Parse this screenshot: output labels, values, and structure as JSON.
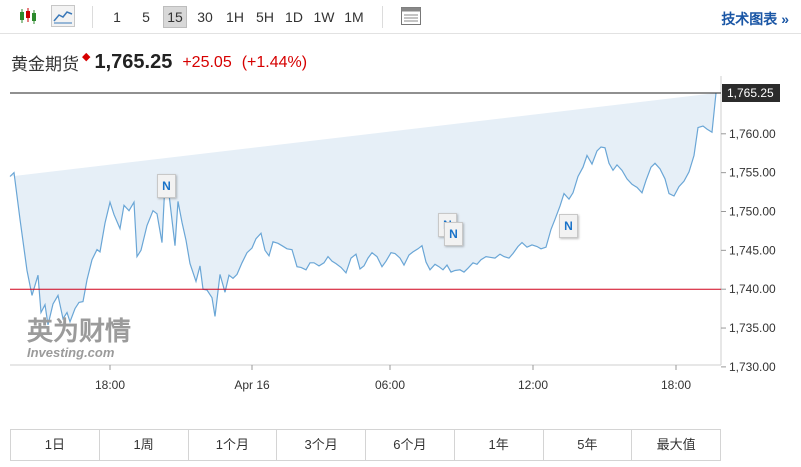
{
  "toolbar": {
    "chart_type_icons": [
      "candlestick-icon",
      "line-chart-icon"
    ],
    "timeframes": [
      "1",
      "5",
      "15",
      "30",
      "1H",
      "5H",
      "1D",
      "1W",
      "1M"
    ],
    "active_timeframe": "15",
    "settings_icon": "table-settings-icon",
    "tech_chart_label": "技术图表 »"
  },
  "header": {
    "name": "黄金期货",
    "arrow": "◆",
    "price": "1,765.25",
    "change": "+25.05",
    "change_pct": "(+1.44%)"
  },
  "watermark": {
    "cn": "英为财情",
    "en": "Investing.com"
  },
  "news_flags": [
    "N",
    "N",
    "N",
    "N"
  ],
  "range_buttons": [
    "1日",
    "1周",
    "1个月",
    "3个月",
    "6个月",
    "1年",
    "5年",
    "最大值"
  ],
  "colors": {
    "line": "#6aa6d6",
    "area": "#e6eff7",
    "ref_line": "#d0021b",
    "price_line": "#222222",
    "up": "#d60000",
    "link": "#1a56a5"
  },
  "chart_data": {
    "type": "area",
    "yticks": [
      "1,730.00",
      "1,735.00",
      "1,740.00",
      "1,745.00",
      "1,750.00",
      "1,755.00",
      "1,760.00"
    ],
    "ylim": [
      1729.4,
      1770
    ],
    "xticks": [
      {
        "label": "18:00",
        "x": 100
      },
      {
        "label": "Apr 16",
        "x": 242
      },
      {
        "label": "06:00",
        "x": 380
      },
      {
        "label": "12:00",
        "x": 523
      },
      {
        "label": "18:00",
        "x": 666
      }
    ],
    "xlim": [
      0,
      711
    ],
    "reference_line": 1740.0,
    "last_price_label": "1,765.25",
    "last_price": 1765.25,
    "x": [
      0,
      4,
      10,
      17,
      22,
      28,
      31,
      35,
      38,
      43,
      48,
      53,
      57,
      60,
      65,
      69,
      73,
      77,
      82,
      87,
      90,
      95,
      100,
      104,
      110,
      114,
      119,
      124,
      127,
      131,
      137,
      143,
      147,
      152,
      155,
      158,
      162,
      165,
      168,
      172,
      176,
      180,
      186,
      190,
      193,
      197,
      202,
      205,
      210,
      215,
      219,
      223,
      227,
      232,
      237,
      242,
      246,
      251,
      255,
      259,
      263,
      268,
      272,
      277,
      282,
      287,
      291,
      296,
      300,
      304,
      309,
      314,
      318,
      322,
      326,
      331,
      336,
      341,
      346,
      350,
      354,
      358,
      362,
      367,
      372,
      376,
      381,
      385,
      390,
      394,
      399,
      403,
      408,
      412,
      416,
      420,
      425,
      429,
      433,
      437,
      441,
      445,
      450,
      454,
      458,
      463,
      467,
      471,
      476,
      480,
      485,
      490,
      494,
      499,
      503,
      508,
      512,
      517,
      522,
      527,
      531,
      536,
      541,
      545,
      550,
      554,
      559,
      563,
      568,
      573,
      577,
      582,
      587,
      591,
      595,
      599,
      603,
      607,
      612,
      617,
      622,
      627,
      632,
      636,
      641,
      645,
      650,
      655,
      659,
      664,
      669,
      674,
      679,
      684,
      688,
      693,
      697,
      702,
      706,
      711
    ],
    "values": [
      1754.5,
      1755.0,
      1749.0,
      1742.4,
      1739.2,
      1741.8,
      1737.0,
      1738.0,
      1735.4,
      1738.1,
      1739.2,
      1736.2,
      1737.0,
      1735.8,
      1737.5,
      1738.3,
      1738.4,
      1741.2,
      1743.8,
      1745.1,
      1744.8,
      1748.5,
      1751.2,
      1749.6,
      1747.8,
      1750.8,
      1750.1,
      1751.2,
      1744.2,
      1745.0,
      1748.2,
      1750.1,
      1749.7,
      1746.0,
      1753.7,
      1753.3,
      1748.9,
      1745.6,
      1751.3,
      1748.6,
      1746.3,
      1743.3,
      1741.0,
      1743.0,
      1740.0,
      1739.9,
      1738.9,
      1736.5,
      1741.9,
      1739.6,
      1741.8,
      1741.4,
      1741.9,
      1743.4,
      1744.7,
      1745.3,
      1746.5,
      1747.2,
      1745.0,
      1744.3,
      1746.1,
      1745.9,
      1745.6,
      1745.2,
      1745.1,
      1742.9,
      1742.8,
      1742.5,
      1743.4,
      1743.4,
      1743.0,
      1743.4,
      1744.2,
      1743.6,
      1743.3,
      1742.8,
      1742.1,
      1744.0,
      1744.5,
      1742.6,
      1743.0,
      1744.0,
      1744.7,
      1744.2,
      1742.9,
      1743.6,
      1744.7,
      1744.6,
      1744.0,
      1743.1,
      1744.4,
      1744.8,
      1745.2,
      1745.6,
      1743.5,
      1742.5,
      1743.2,
      1742.9,
      1742.5,
      1743.1,
      1742.2,
      1742.4,
      1742.5,
      1742.2,
      1742.7,
      1743.4,
      1743.2,
      1743.8,
      1744.2,
      1744.1,
      1744.0,
      1744.5,
      1744.2,
      1744.0,
      1744.6,
      1745.5,
      1746.0,
      1745.4,
      1745.7,
      1745.5,
      1745.2,
      1745.4,
      1747.7,
      1749.0,
      1750.7,
      1752.3,
      1751.6,
      1752.4,
      1754.5,
      1755.7,
      1757.2,
      1756.1,
      1757.8,
      1758.3,
      1758.2,
      1756.2,
      1755.3,
      1756.0,
      1755.3,
      1754.2,
      1753.5,
      1753.1,
      1752.4,
      1754.0,
      1755.7,
      1756.2,
      1755.5,
      1754.2,
      1752.3,
      1752.0,
      1753.2,
      1753.9,
      1755.1,
      1757.2,
      1760.8,
      1761.0,
      1760.6,
      1760.2,
      1765.25
    ]
  }
}
